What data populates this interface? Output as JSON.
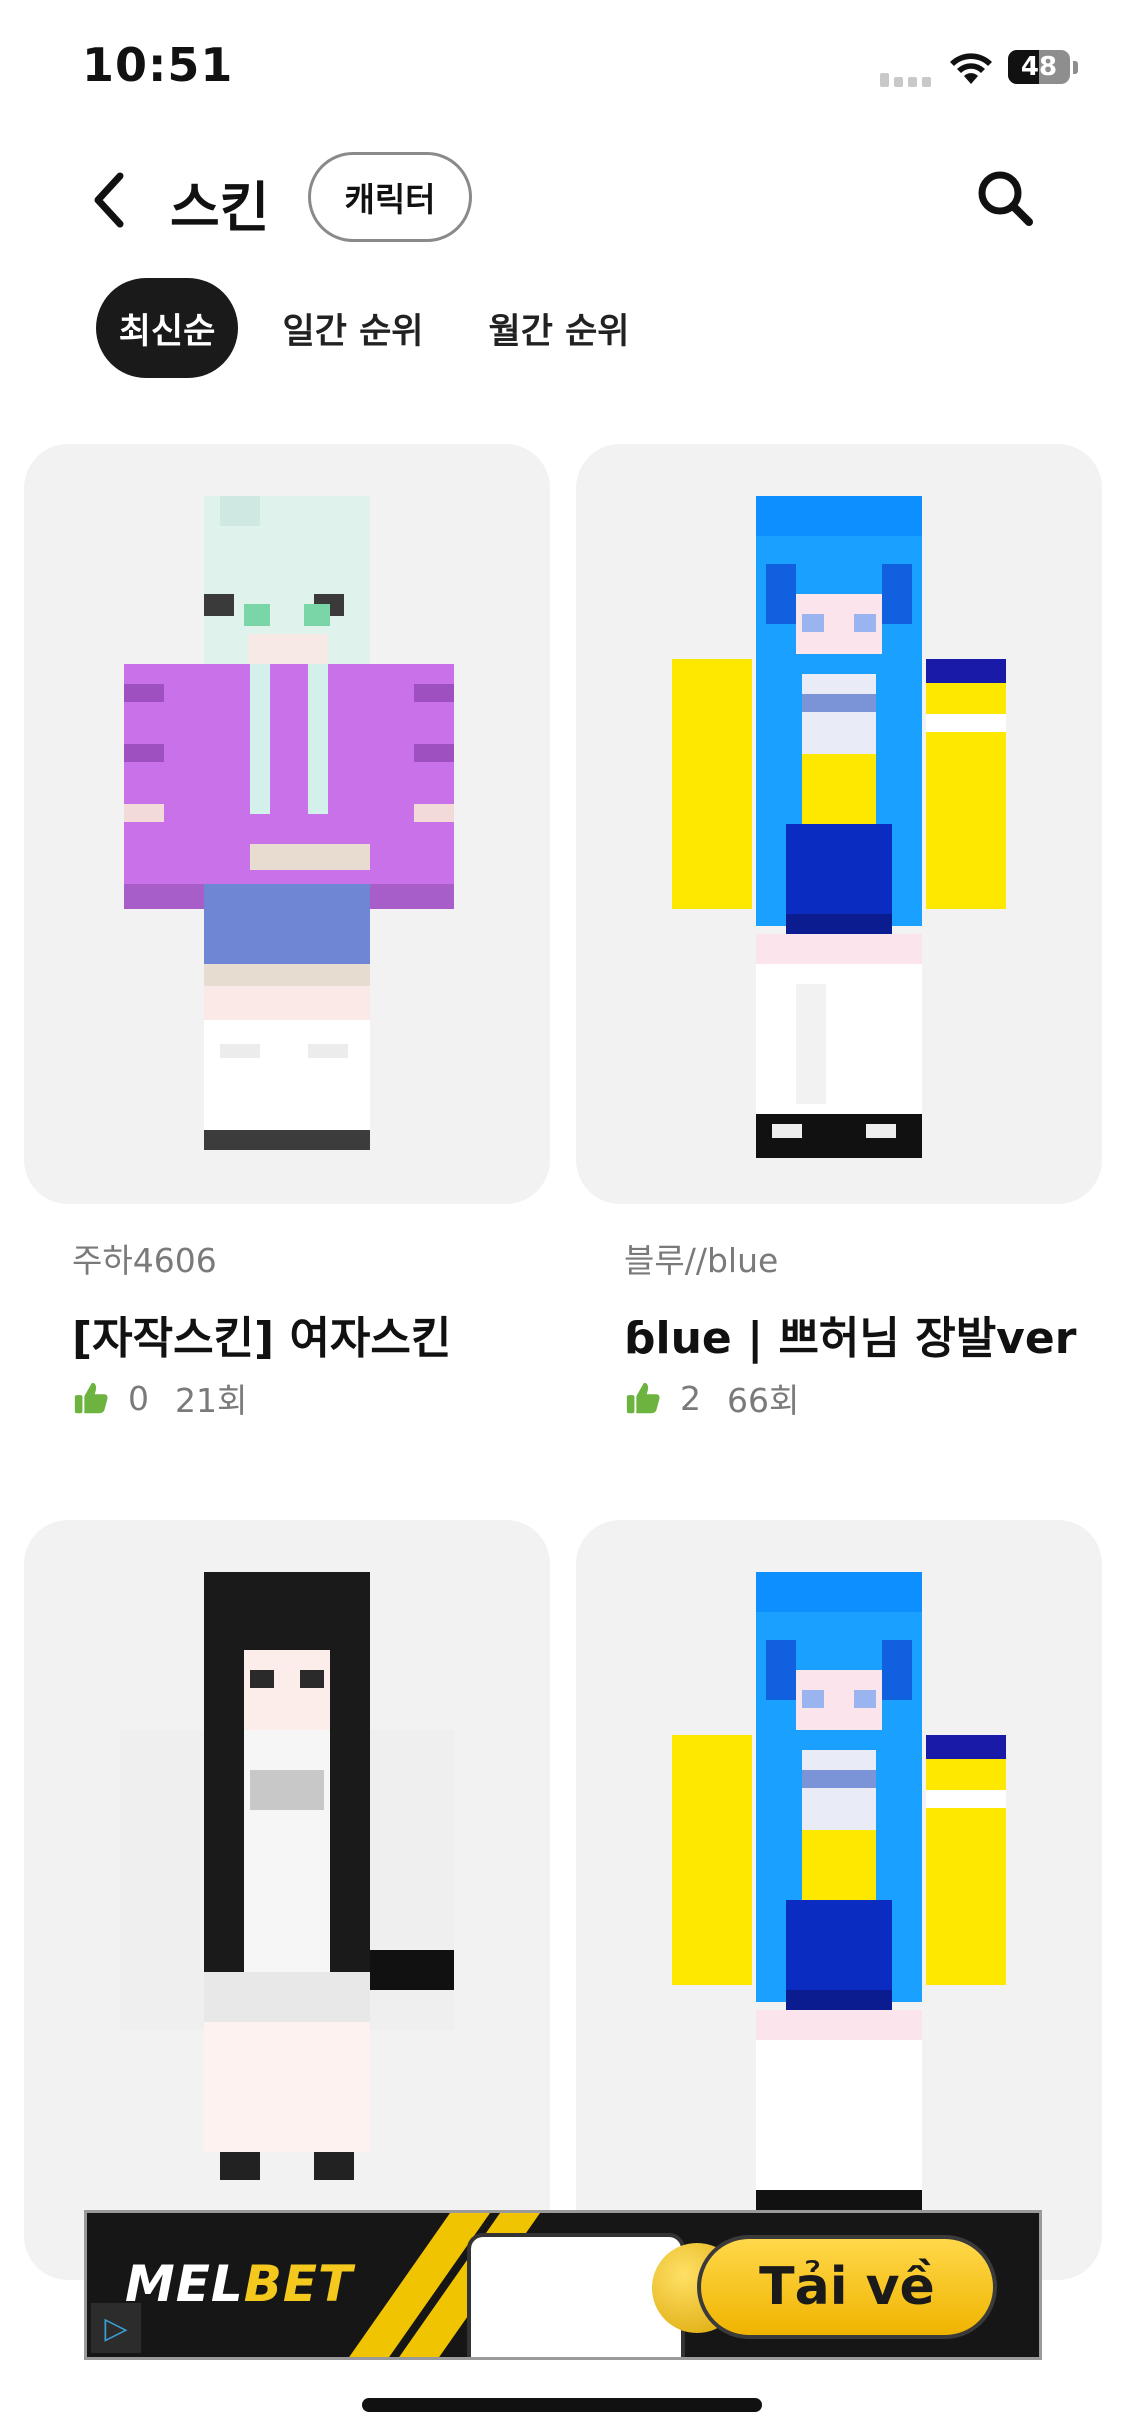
{
  "status_bar": {
    "time": "10:51",
    "battery": "48"
  },
  "header": {
    "title": "스킨",
    "filter_chip": "캐릭터"
  },
  "tabs": [
    {
      "label": "최신순",
      "active": true
    },
    {
      "label": "일간 순위",
      "active": false
    },
    {
      "label": "월간 순위",
      "active": false
    }
  ],
  "skins": [
    {
      "author": "주하4606",
      "name": "[자작스킨] 여자스킨",
      "likes": "0",
      "views": "21회"
    },
    {
      "author": "블루//blue",
      "name": "ɓlue | 쁘허님 장발ver",
      "likes": "2",
      "views": "66회"
    },
    {
      "author": "",
      "name": "",
      "likes": "",
      "views": ""
    },
    {
      "author": "",
      "name": "",
      "likes": "",
      "views": ""
    }
  ],
  "ad": {
    "brand_part1": "MEL",
    "brand_part2": "BET",
    "cta": "Tải về"
  },
  "colors": {
    "like_icon": "#6db33f",
    "active_tab_bg": "#1a1a1a",
    "card_bg": "#f2f2f2"
  }
}
